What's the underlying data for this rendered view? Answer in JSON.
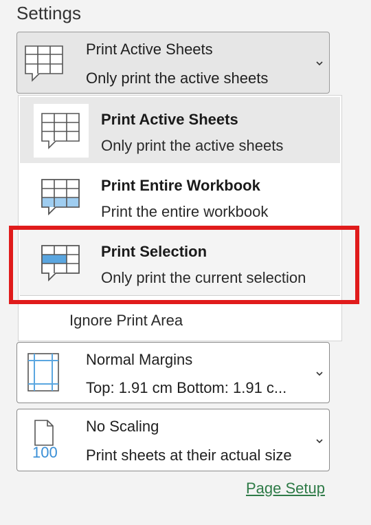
{
  "settings": {
    "heading": "Settings"
  },
  "print_what": {
    "selected_title": "Print Active Sheets",
    "selected_desc": "Only print the active sheets",
    "chevron_icon": "chevron-down-icon",
    "options": [
      {
        "title": "Print Active Sheets",
        "desc": "Only print the active sheets",
        "icon": "active-sheets-icon",
        "state": "selected"
      },
      {
        "title": "Print Entire Workbook",
        "desc": "Print the entire workbook",
        "icon": "entire-workbook-icon",
        "state": "normal"
      },
      {
        "title": "Print Selection",
        "desc": "Only print the current selection",
        "icon": "selection-icon",
        "state": "highlighted"
      }
    ],
    "ignore_print_area": "Ignore Print Area"
  },
  "margins": {
    "title": "Normal Margins",
    "desc": "Top: 1.91 cm Bottom: 1.91 c...",
    "icon": "margins-icon"
  },
  "scaling": {
    "title": "No Scaling",
    "desc": "Print sheets at their actual size",
    "icon_number": "100",
    "icon": "page-scale-icon"
  },
  "footer": {
    "page_setup_link": "Page Setup"
  },
  "colors": {
    "highlight_border": "#e01b1b",
    "accent_blue": "#9fcdf0",
    "link_green": "#2d7a46"
  }
}
